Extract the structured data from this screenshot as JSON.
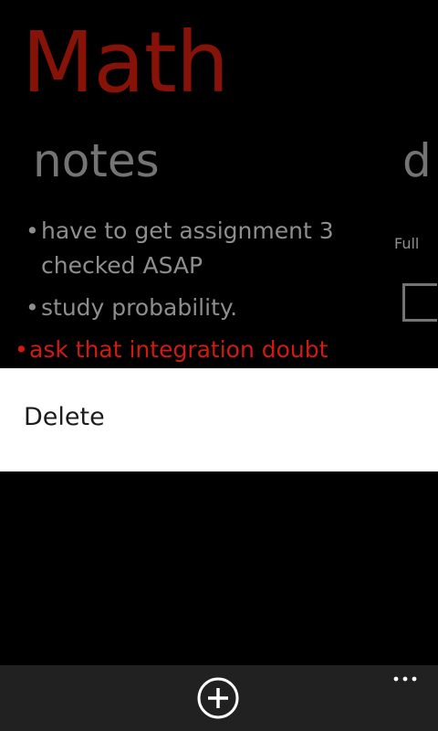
{
  "header": {
    "app_title": "Math",
    "section_title": "notes",
    "next_section_title": "d"
  },
  "notes": [
    {
      "bullet": "•",
      "text": "have to get assignment 3 checked ASAP"
    },
    {
      "bullet": "•",
      "text": "study probability."
    },
    {
      "bullet": "•",
      "text": "ask that integration doubt",
      "selected": true
    }
  ],
  "side_panel": {
    "label": "Full"
  },
  "context_menu": {
    "delete_label": "Delete"
  },
  "app_bar": {
    "add_icon": "add-circle-icon",
    "more_icon": "more-ellipsis-icon"
  },
  "colors": {
    "accent": "#d11b10",
    "title": "#861208",
    "text_secondary": "#8e8e8e",
    "app_bar_bg": "#212121",
    "menu_bg": "#ffffff"
  }
}
